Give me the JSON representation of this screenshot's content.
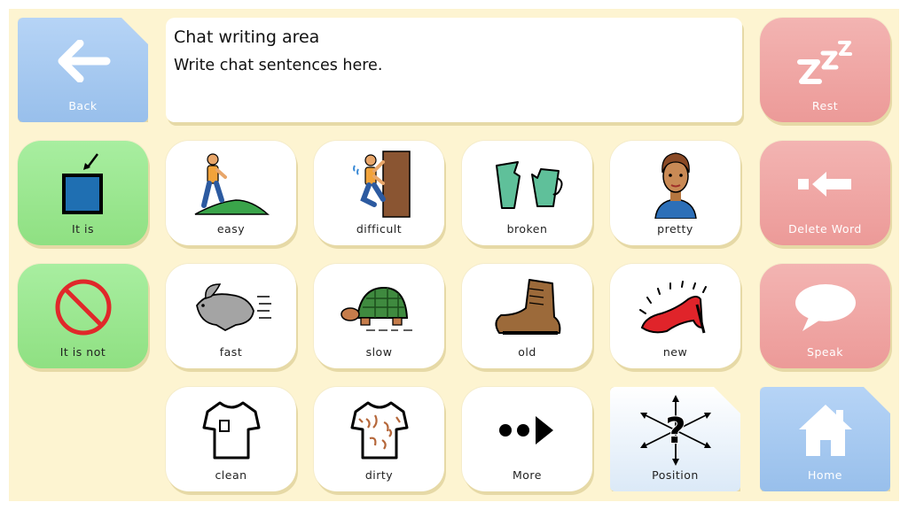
{
  "chat": {
    "title": "Chat writing area",
    "hint": "Write chat sentences here."
  },
  "buttons": {
    "back": "Back",
    "rest": "Rest",
    "it_is": "It is",
    "delete_word": "Delete Word",
    "it_is_not": "It is not",
    "speak": "Speak",
    "home": "Home",
    "more": "More",
    "position": "Position"
  },
  "words": {
    "easy": "easy",
    "difficult": "difficult",
    "broken": "broken",
    "pretty": "pretty",
    "fast": "fast",
    "slow": "slow",
    "old": "old",
    "new": "new",
    "clean": "clean",
    "dirty": "dirty"
  },
  "colors": {
    "background": "#fdf4d1",
    "green": "#95e488",
    "red": "#ee9f9d",
    "blue": "#a3c7ee"
  }
}
